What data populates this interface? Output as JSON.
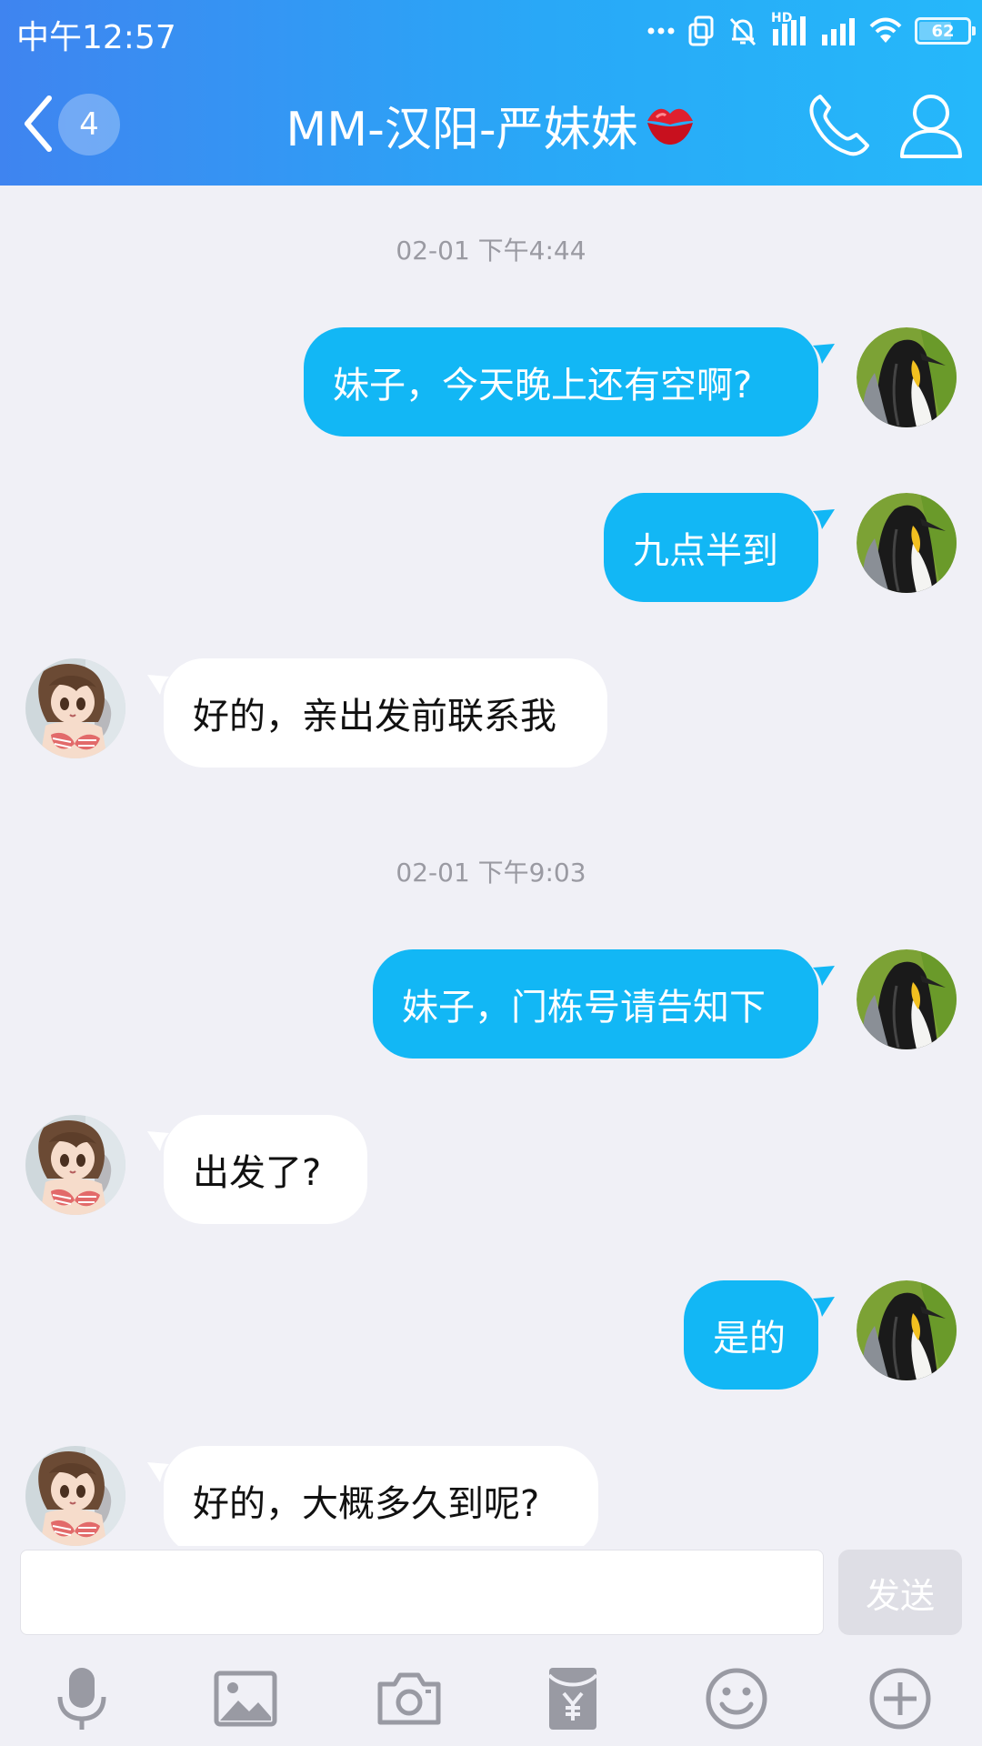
{
  "status_bar": {
    "time": "中午12:57",
    "network_label": "HD",
    "battery_level": "62"
  },
  "header": {
    "unread_count": "4",
    "title": "MM-汉阳-严妹妹",
    "title_emoji": "lips-icon"
  },
  "messages": [
    {
      "type": "timestamp",
      "text": "02-01 下午4:44"
    },
    {
      "type": "out",
      "text": "妹子，今天晚上还有空啊?"
    },
    {
      "type": "out",
      "text": "九点半到"
    },
    {
      "type": "in",
      "text": "好的，亲出发前联系我"
    },
    {
      "type": "timestamp",
      "text": "02-01 下午9:03"
    },
    {
      "type": "out",
      "text": "妹子，门栋号请告知下"
    },
    {
      "type": "in",
      "text": "出发了?"
    },
    {
      "type": "out",
      "text": "是的"
    },
    {
      "type": "in",
      "text": "好的，大概多久到呢?"
    }
  ],
  "input": {
    "value": "",
    "placeholder": "",
    "send_label": "发送"
  },
  "toolbar": [
    "microphone-icon",
    "image-icon",
    "camera-icon",
    "red-packet-icon",
    "emoji-icon",
    "plus-icon"
  ],
  "colors": {
    "header_start": "#3f84f0",
    "header_end": "#25b8fa",
    "outgoing_bubble": "#12b7f5",
    "incoming_bubble": "#ffffff",
    "chat_background": "#f0f0f6"
  }
}
